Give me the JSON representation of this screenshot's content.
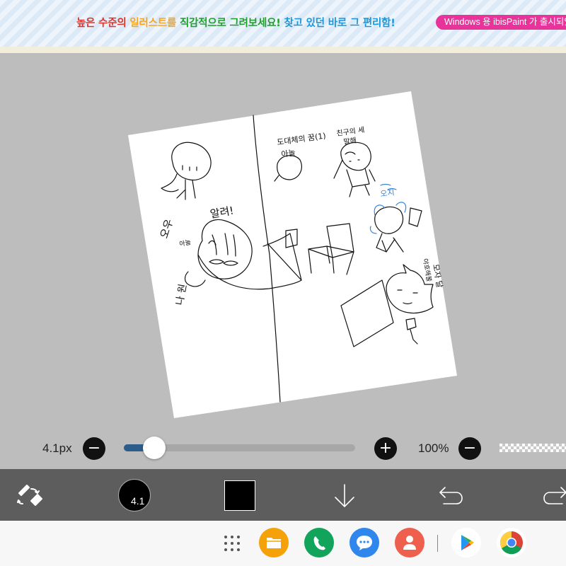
{
  "banner": {
    "seg1": "높은 수준의 ",
    "seg2": "일러스트를 ",
    "seg3": "직감적으로 ",
    "seg4": "그려보세요! ",
    "seg5": "찾고 있던 바로 그 편리함!",
    "badge": "Windows 용 ibisPaint 가 출시되었습니다"
  },
  "canvas": {
    "paper_texts": [
      "도대체의 꿈(1)",
      "아놀",
      "친구의 세",
      "말해",
      "오우",
      "알려!",
      "아놀",
      "나 원",
      "오지",
      "야호해볼",
      "모자 달"
    ]
  },
  "brush_slider": {
    "size_label": "4.1px",
    "minus_label": "−",
    "plus_label": "+",
    "value_fraction": 0.13
  },
  "opacity_slider": {
    "label": "100%",
    "minus_label": "−",
    "value_fraction": 1.0
  },
  "toolbar": {
    "tool_icon": "brush-eraser-swap-icon",
    "brush_size_text": "4.1",
    "current_color": "#000000",
    "layer_icon": "arrow-down-icon",
    "undo_icon": "undo-icon",
    "redo_icon": "redo-icon"
  },
  "navbar": {
    "apps": [
      "app-grid-icon",
      "my-files-icon",
      "phone-icon",
      "messages-icon",
      "contacts-icon",
      "play-store-icon",
      "chrome-icon"
    ]
  },
  "colors": {
    "slider_fill": "#2c5c8a",
    "banner_badge": "#e8339b",
    "toolbar_bg": "#5d5d5d"
  }
}
